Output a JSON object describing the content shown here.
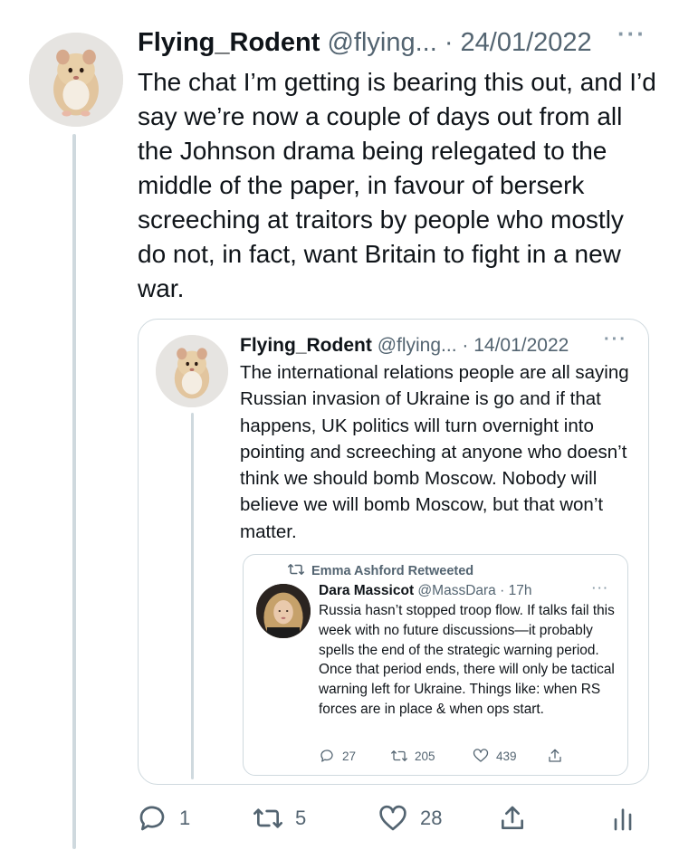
{
  "main_tweet": {
    "display_name": "Flying_Rodent",
    "handle": "@flying...",
    "separator": " · ",
    "date": "24/01/2022",
    "more": "···",
    "text": "The chat I’m getting is bearing this out, and I’d say we’re now a couple of days out from all the Johnson drama being relegated to the middle of the paper, in favour of berserk screeching at traitors by people who mostly do not, in fact, want Britain to fight in a new war.",
    "actions": {
      "replies": "1",
      "retweets": "5",
      "likes": "28"
    }
  },
  "quoted_tweet": {
    "display_name": "Flying_Rodent",
    "handle": "@flying...",
    "separator": " · ",
    "date": "14/01/2022",
    "more": "···",
    "text": "The international relations people are all saying Russian invasion of Ukraine is go and if that happens, UK politics will turn overnight into pointing and screeching at anyone who doesn’t think we should bomb Moscow. Nobody will believe we will bomb Moscow, but that won’t matter."
  },
  "inner_tweet": {
    "retweeted_by": "Emma Ashford Retweeted",
    "display_name": "Dara Massicot",
    "handle": "@MassDara",
    "separator": " · ",
    "time": "17h",
    "more": "···",
    "text": "Russia hasn’t stopped troop flow. If talks fail this week with no future discussions—it probably spells the end of the strategic warning period. Once that period ends, there will only be tactical warning left for Ukraine. Things like: when RS forces are in place & when ops start.",
    "actions": {
      "replies": "27",
      "retweets": "205",
      "likes": "439"
    }
  },
  "icons": {
    "reply": "reply-icon",
    "retweet": "retweet-icon",
    "like": "heart-icon",
    "share": "share-icon",
    "analytics": "analytics-icon",
    "more": "more-icon"
  }
}
